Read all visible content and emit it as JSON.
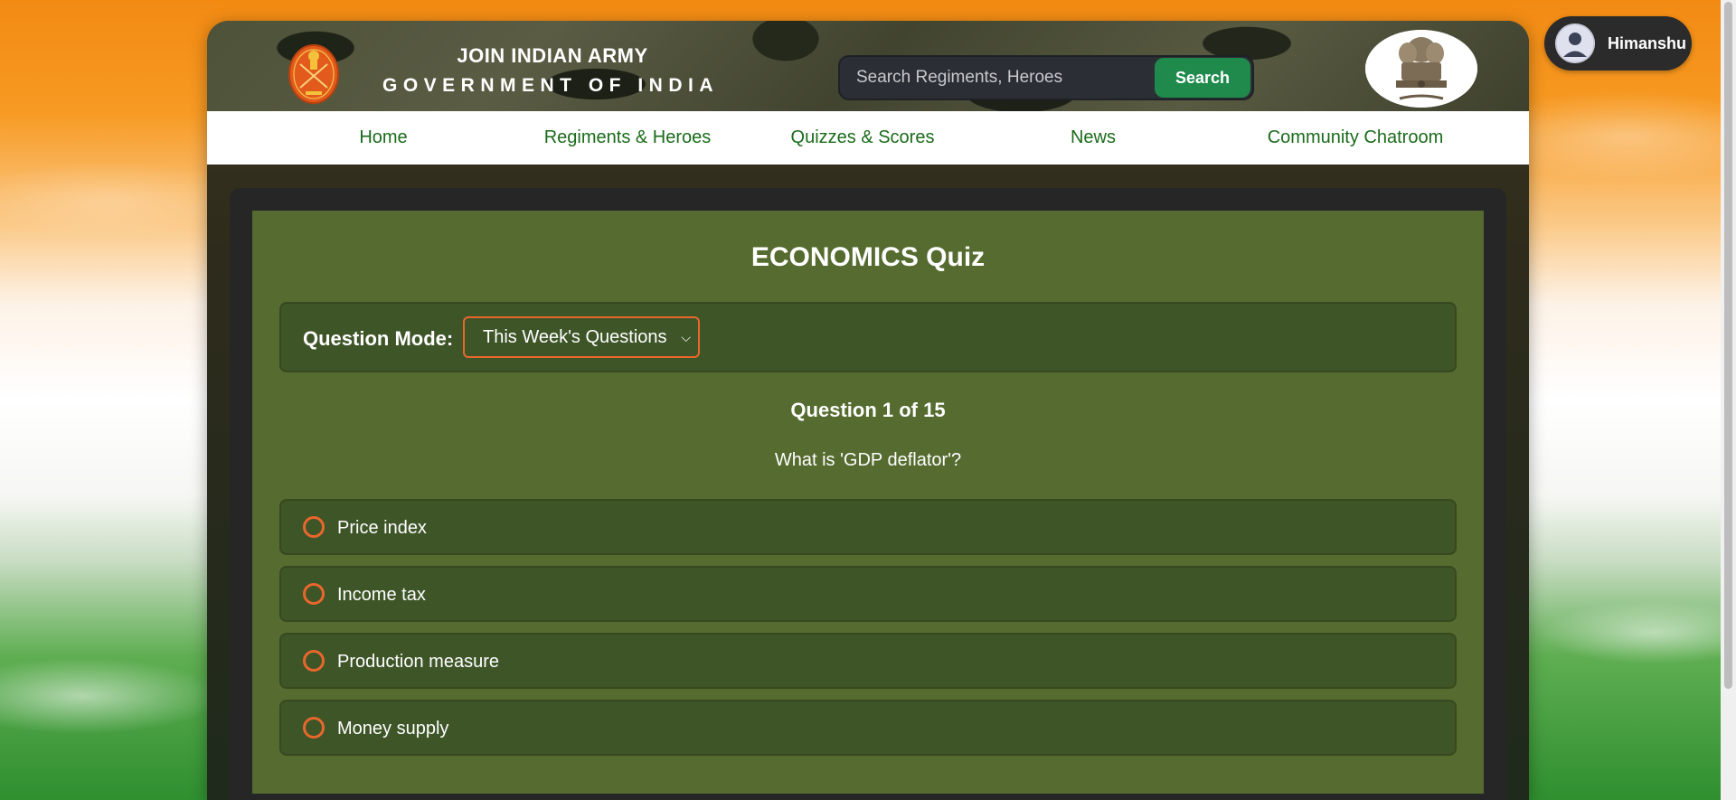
{
  "header": {
    "title_line_1": "JOIN INDIAN ARMY",
    "title_line_2": "GOVERNMENT OF INDIA",
    "search": {
      "placeholder": "Search Regiments, Heroes",
      "button_label": "Search"
    }
  },
  "nav": {
    "items": [
      {
        "label": "Home"
      },
      {
        "label": "Regiments & Heroes"
      },
      {
        "label": "Quizzes & Scores"
      },
      {
        "label": "News"
      },
      {
        "label": "Community Chatroom"
      }
    ]
  },
  "quiz": {
    "title": "ECONOMICS Quiz",
    "mode_label": "Question Mode:",
    "mode_selected": "This Week's Questions",
    "counter": "Question 1 of 15",
    "question": "What is 'GDP deflator'?",
    "options": [
      {
        "label": "Price index"
      },
      {
        "label": "Income tax"
      },
      {
        "label": "Production measure"
      },
      {
        "label": "Money supply"
      }
    ]
  },
  "user": {
    "name": "Himanshu"
  },
  "colors": {
    "accent_orange": "#e8672d",
    "nav_green": "#1a6b1a",
    "search_button": "#1f8a4c",
    "quiz_panel": "#556b2f",
    "option_bg": "#3e5528"
  },
  "icons": {
    "army_emblem": "indian-army-emblem",
    "national_emblem": "ashoka-lion-capital",
    "avatar": "user-avatar"
  }
}
